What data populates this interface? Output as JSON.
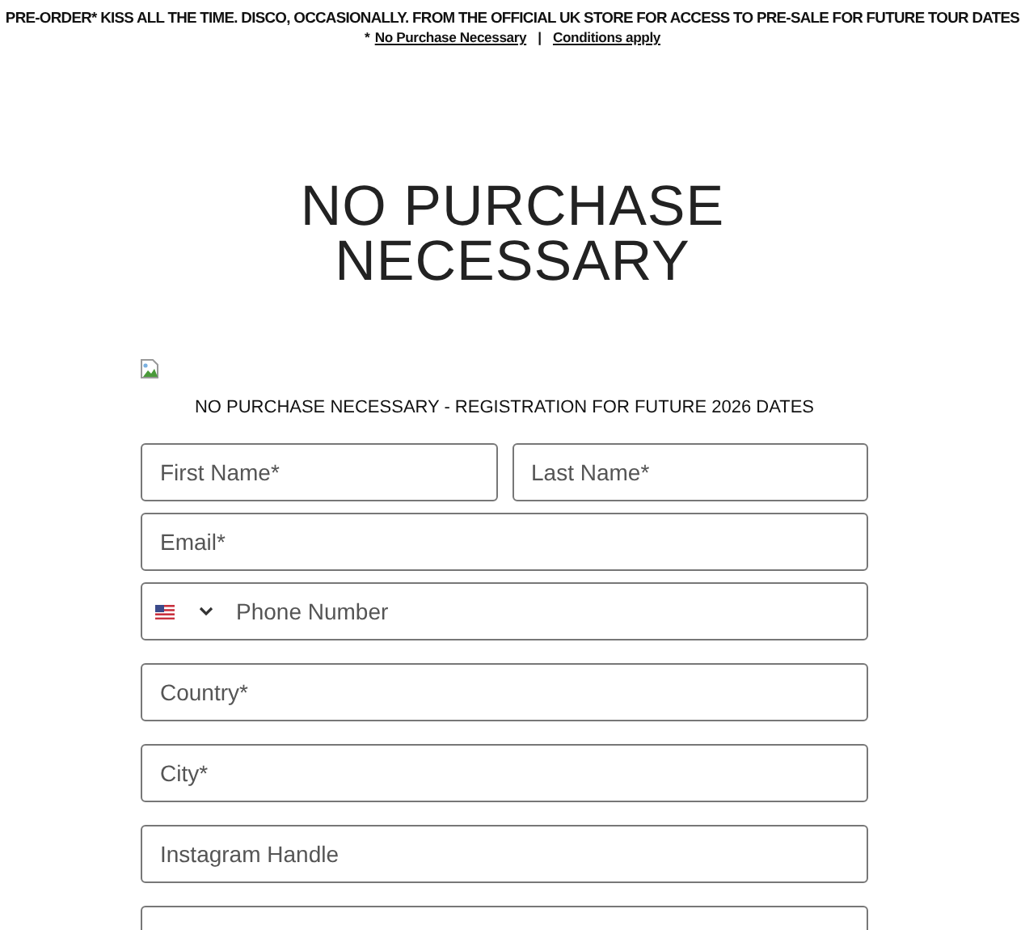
{
  "banner": {
    "text": "PRE-ORDER* KISS ALL THE TIME. DISCO, OCCASIONALLY. FROM THE OFFICIAL UK STORE FOR ACCESS TO PRE-SALE FOR FUTURE TOUR DATES",
    "note_mark": "*",
    "links": [
      "No Purchase Necessary",
      "Conditions apply"
    ],
    "separator": "|"
  },
  "heading": "NO PURCHASE NECESSARY",
  "subtitle": "NO PURCHASE NECESSARY - REGISTRATION FOR FUTURE 2026 DATES",
  "form": {
    "rows": [
      {
        "fields": [
          {
            "kind": "text",
            "placeholder": "First Name*"
          },
          {
            "kind": "text",
            "placeholder": "Last Name*"
          }
        ]
      },
      {
        "fields": [
          {
            "kind": "text",
            "placeholder": "Email*"
          }
        ]
      },
      {
        "fields": [
          {
            "kind": "phone",
            "placeholder": "Phone Number"
          }
        ]
      },
      {
        "fields": [
          {
            "kind": "text",
            "placeholder": "Country*"
          }
        ]
      },
      {
        "fields": [
          {
            "kind": "text",
            "placeholder": "City*"
          }
        ]
      },
      {
        "fields": [
          {
            "kind": "text",
            "placeholder": "Instagram Handle"
          }
        ]
      },
      {
        "fields": [
          {
            "kind": "text"
          }
        ]
      }
    ]
  }
}
